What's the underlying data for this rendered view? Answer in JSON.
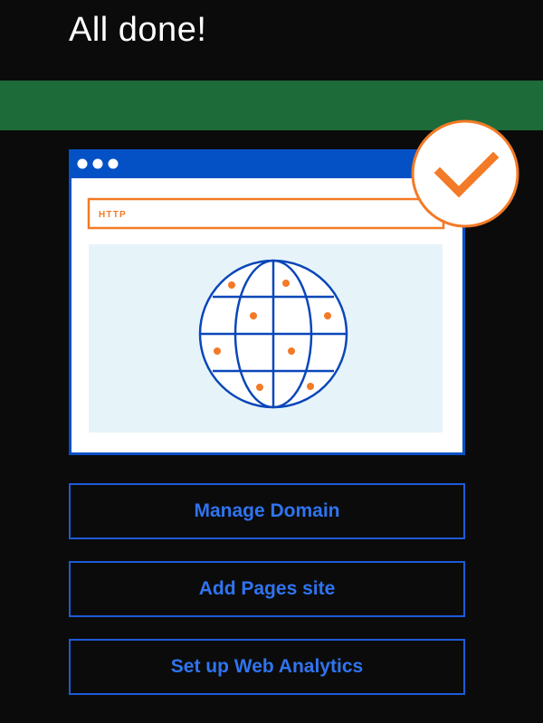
{
  "header": {
    "title": "All done!"
  },
  "illustration": {
    "url_bar_text": "HTTP",
    "colors": {
      "browser_blue": "#0451c6",
      "orange": "#f37a26",
      "globe_blue": "#0a47b9",
      "content_bg": "#e6f4fa",
      "header_green": "#1d6b38",
      "button_blue": "#2f74f0"
    },
    "icons": [
      "window-dots-icon",
      "globe-icon",
      "checkmark-icon"
    ]
  },
  "actions": [
    {
      "label": "Manage Domain"
    },
    {
      "label": "Add Pages site"
    },
    {
      "label": "Set up Web Analytics"
    }
  ]
}
